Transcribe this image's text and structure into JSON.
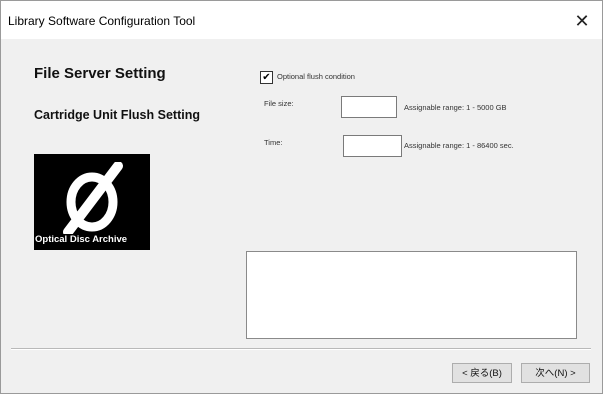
{
  "window": {
    "title": "Library Software Configuration Tool",
    "close_glyph": "✕"
  },
  "page": {
    "heading": "File Server Setting",
    "subheading": "Cartridge Unit Flush Setting"
  },
  "logo": {
    "text": "Optical Disc Archive"
  },
  "form": {
    "flush_checkbox": {
      "label": "Optional flush condition",
      "checked": true,
      "glyph": "✔"
    },
    "file_size": {
      "label": "File size:",
      "value": "",
      "range": "Assignable range: 1 - 5000 GB"
    },
    "time": {
      "label": "Time:",
      "value": "",
      "range": "Assignable range: 1 - 86400 sec."
    }
  },
  "message_box": {
    "value": ""
  },
  "buttons": {
    "back_label": "< 戻る(B)",
    "next_label": "次へ(N) >"
  }
}
